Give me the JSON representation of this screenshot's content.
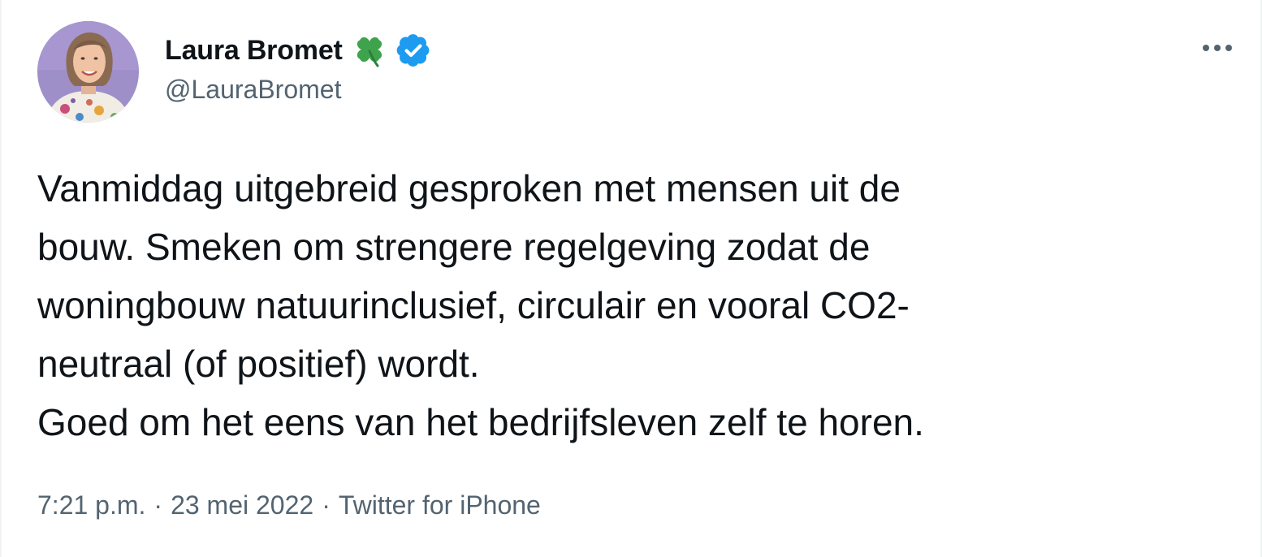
{
  "author": {
    "display_name": "Laura Bromet",
    "handle": "@LauraBromet",
    "badges": [
      "four-leaf-clover-icon",
      "verified-badge-icon"
    ],
    "avatar": "profile-photo"
  },
  "tweet": {
    "lines": [
      "Vanmiddag uitgebreid gesproken met mensen uit de",
      "bouw. Smeken om strengere regelgeving zodat de",
      "woningbouw natuurinclusief, circulair en vooral CO2-",
      "neutraal (of positief) wordt.",
      "Goed om het eens van het bedrijfsleven zelf te horen."
    ]
  },
  "meta": {
    "time": "7:21 p.m.",
    "separator": "·",
    "date": "23 mei 2022",
    "source": "Twitter for iPhone"
  },
  "menu": {
    "icon": "more-options-icon"
  },
  "colors": {
    "text": "#0f1419",
    "secondary": "#536471",
    "verified": "#1d9bf0",
    "clover": "#3fa34d",
    "avatar_bg": "#9f8fc9"
  }
}
